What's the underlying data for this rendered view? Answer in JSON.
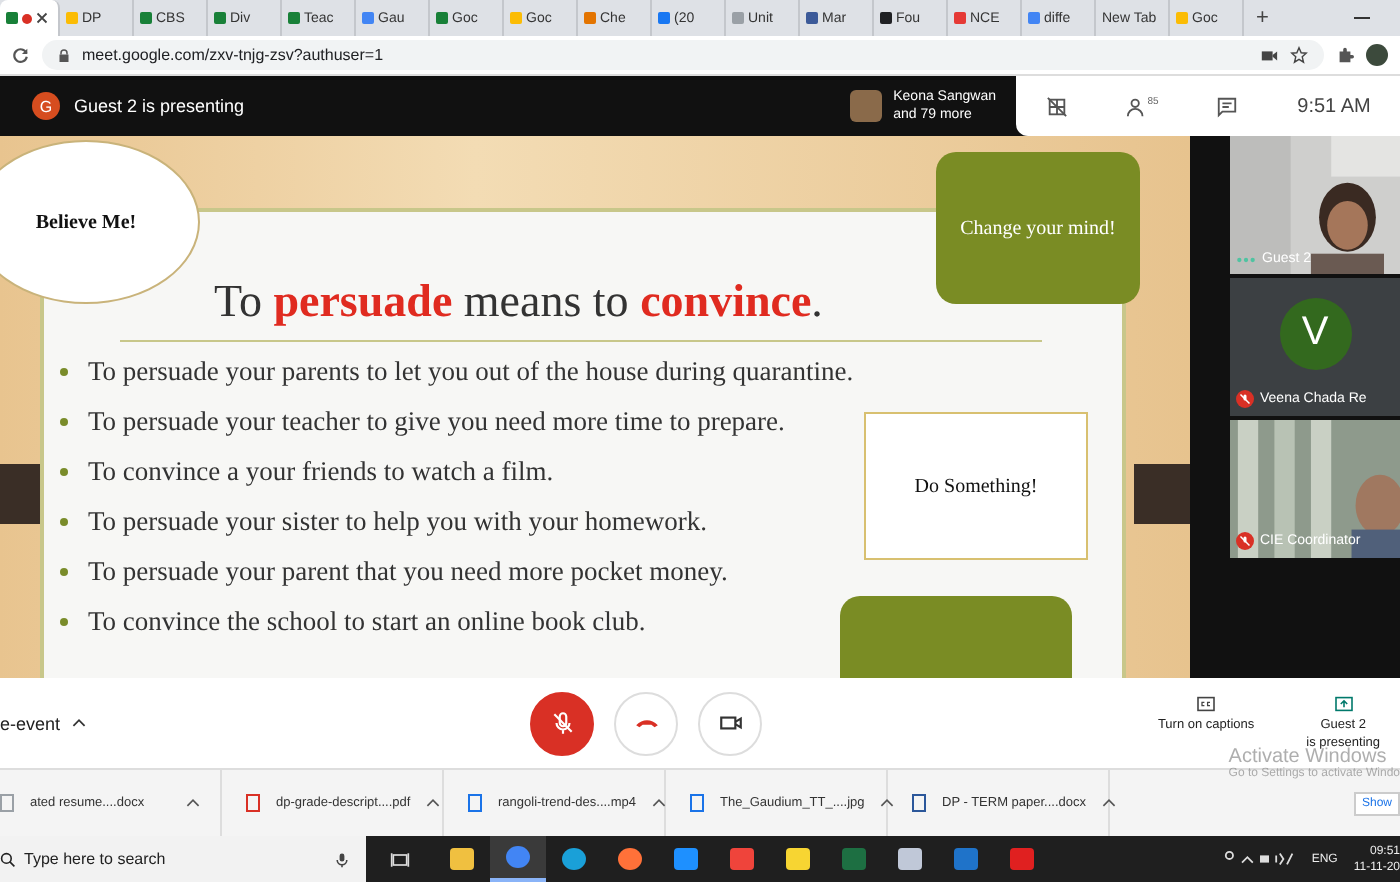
{
  "browser": {
    "tabs": [
      {
        "selected": true,
        "color": "#188038"
      },
      {
        "label": "DP",
        "selected": false,
        "color": "#fbbc04"
      },
      {
        "label": "CBS",
        "selected": false,
        "color": "#188038"
      },
      {
        "label": "Div",
        "selected": false,
        "color": "#188038"
      },
      {
        "label": "Teac",
        "selected": false,
        "color": "#188038"
      },
      {
        "label": "Gau",
        "selected": false,
        "color": "#4285f4"
      },
      {
        "label": "Goc",
        "selected": false,
        "color": "#188038"
      },
      {
        "label": "Goc",
        "selected": false,
        "color": "#fbbc04"
      },
      {
        "label": "Che",
        "selected": false,
        "color": "#e37400"
      },
      {
        "label": "(20",
        "selected": false,
        "color": "#1877f2"
      },
      {
        "label": "Unit",
        "selected": false,
        "color": "#9aa0a6"
      },
      {
        "label": "Mar",
        "selected": false,
        "color": "#3c5a99"
      },
      {
        "label": "Fou",
        "selected": false,
        "color": "#202124"
      },
      {
        "label": "NCE",
        "selected": false,
        "color": "#e53935"
      },
      {
        "label": "diffe",
        "selected": false,
        "color": "#4285f4"
      },
      {
        "label": "New Tab",
        "selected": false
      },
      {
        "label": "Goc",
        "selected": false,
        "color": "#fbbc04"
      }
    ],
    "new_tab": "+",
    "url": "meet.google.com/zxv-tnjg-zsv?authuser=1"
  },
  "meet_header": {
    "avatar_letter": "G",
    "presenting": "Guest 2 is presenting",
    "viewer_name": "Keona Sangwan",
    "viewer_more": "and 79 more",
    "people_count": "85",
    "time": "9:51  AM"
  },
  "slide": {
    "title": "To **persuade** means to **convince**.",
    "bubbles": [
      {
        "kind": "white-round",
        "text": "Believe Me!"
      },
      {
        "kind": "green",
        "text": "Change your mind!"
      },
      {
        "kind": "white-box",
        "text": "Do Something!"
      },
      {
        "kind": "green-empty"
      }
    ],
    "bullets": [
      "To persuade your parents to let you out of the house during quarantine.",
      "To persuade your teacher to give you need more time to prepare.",
      "To convince a your friends to watch a film.",
      "To persuade your sister to help you with your homework.",
      "To persuade your parent that you need more pocket money.",
      "To convince the school to start an online book club."
    ]
  },
  "participants": [
    {
      "kind": "video",
      "name": "Guest 2",
      "muted": false
    },
    {
      "kind": "avatar",
      "letter": "V",
      "name": "Veena Chada Re",
      "muted": true
    },
    {
      "kind": "video",
      "name": "CIE Coordinator",
      "muted": true
    }
  ],
  "meeting_name": "e-event",
  "controls": {
    "mic_muted": true
  },
  "captions_label": "Turn on captions",
  "presenting_label": [
    "Guest 2",
    "is presenting"
  ],
  "os_notice": [
    "Activate Windows",
    "Go to Settings to activate Windo"
  ],
  "downloads": [
    {
      "kind": "docx",
      "name": "ated resume....docx"
    },
    {
      "kind": "pdf",
      "name": "dp-grade-descript....pdf"
    },
    {
      "kind": "mp4",
      "name": "rangoli-trend-des....mp4"
    },
    {
      "kind": "jpg",
      "name": "The_Gaudium_TT_....jpg"
    },
    {
      "kind": "word",
      "name": "DP - TERM paper....docx"
    }
  ],
  "show_all": "Show",
  "taskbar": {
    "search_placeholder": "Type here to search",
    "apps": [
      {
        "kind": "explorer",
        "selected": false
      },
      {
        "kind": "chrome",
        "selected": true
      },
      {
        "kind": "edge",
        "selected": false
      },
      {
        "kind": "firefox",
        "selected": false
      },
      {
        "kind": "ie",
        "selected": false
      },
      {
        "kind": "anydesk",
        "selected": false
      },
      {
        "kind": "sticky",
        "selected": false
      },
      {
        "kind": "excel",
        "selected": false
      },
      {
        "kind": "paint",
        "selected": false
      },
      {
        "kind": "media",
        "selected": false
      },
      {
        "kind": "acrobat",
        "selected": false
      }
    ],
    "lang": "ENG",
    "time": "09:51",
    "date": "11-11-20"
  }
}
